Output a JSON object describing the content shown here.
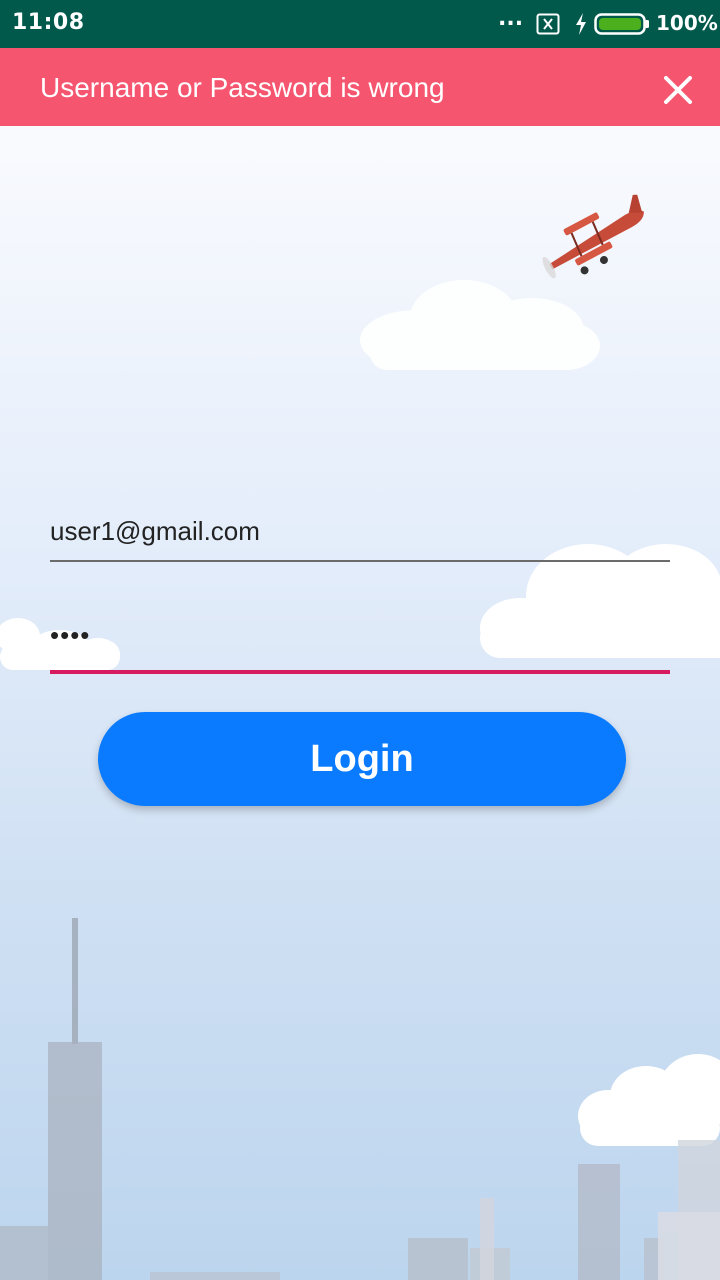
{
  "status_bar": {
    "time": "11:08",
    "more_indicator": "...",
    "battery_percent": "100%",
    "icons": [
      "sim-off-icon",
      "charging-icon",
      "battery-icon"
    ]
  },
  "error_banner": {
    "message": "Username or Password is wrong",
    "close_icon": "close-icon",
    "background": "#f5556f"
  },
  "form": {
    "email_value": "user1@gmail.com",
    "password_value": "••••",
    "login_label": "Login"
  },
  "colors": {
    "status_bar": "#01594c",
    "accent": "#d81b60",
    "button": "#0a7bff"
  }
}
